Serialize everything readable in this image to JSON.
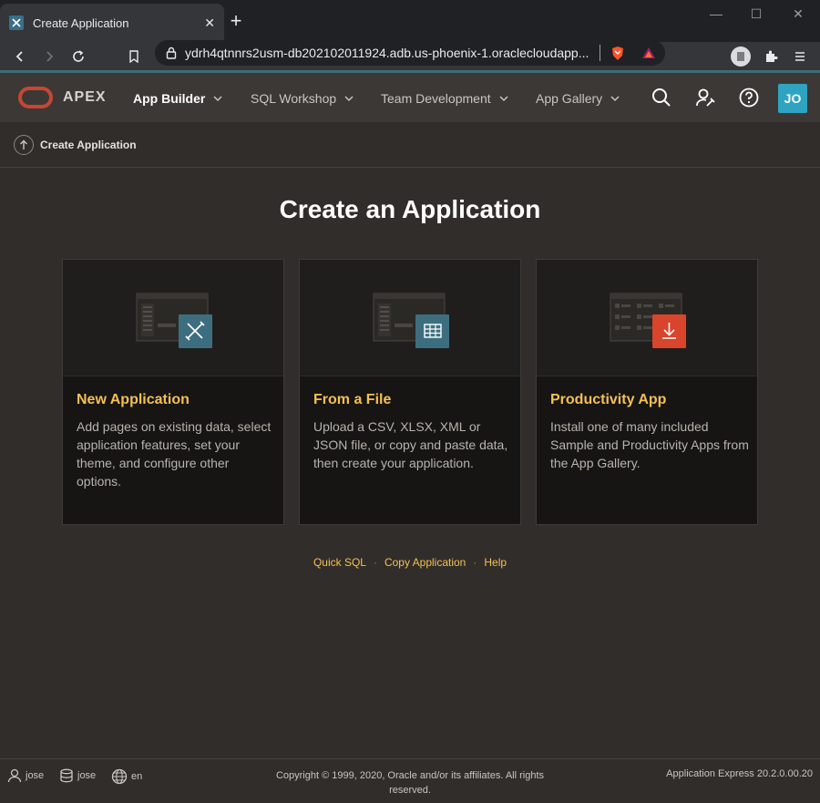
{
  "browser": {
    "tab_title": "Create Application",
    "new_tab": "+",
    "address": "ydrh4qtnnrs2usm-db202102011924.adb.us-phoenix-1.oraclecloudapp..."
  },
  "header": {
    "product": "APEX",
    "menus": [
      {
        "label": "App Builder"
      },
      {
        "label": "SQL Workshop"
      },
      {
        "label": "Team Development"
      },
      {
        "label": "App Gallery"
      }
    ],
    "avatar": "JO"
  },
  "breadcrumb": {
    "label": "Create Application"
  },
  "main": {
    "title": "Create an Application",
    "cards": [
      {
        "title": "New Application",
        "desc": "Add pages on existing data, select application features, set your theme, and configure other options.",
        "icon": "wrench-pencil-icon",
        "accent": "#3d6e7f"
      },
      {
        "title": "From a File",
        "desc": "Upload a CSV, XLSX, XML or JSON file, or copy and paste data, then create your application.",
        "icon": "table-grid-icon",
        "accent": "#3d6e7f"
      },
      {
        "title": "Productivity App",
        "desc": "Install one of many included Sample and Productivity Apps from the App Gallery.",
        "icon": "download-icon",
        "accent": "#d9442c"
      }
    ],
    "links": [
      "Quick SQL",
      "Copy Application",
      "Help"
    ]
  },
  "footer": {
    "user": "jose",
    "schema": "jose",
    "language": "en",
    "copyright": "Copyright © 1999, 2020, Oracle and/or its affiliates. All rights reserved.",
    "version": "Application Express 20.2.0.00.20"
  }
}
